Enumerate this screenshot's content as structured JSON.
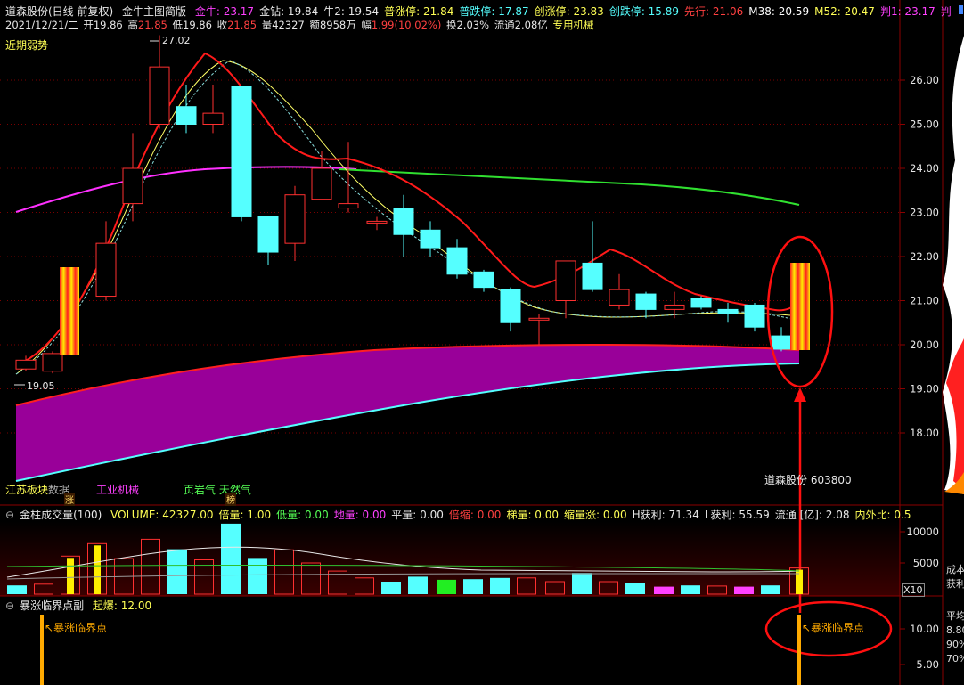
{
  "header": {
    "stock": "道森股份(日线 前复权)",
    "panel": "金牛主图简版",
    "items": [
      {
        "label": "金牛: 23.17",
        "color": "#ff40ff"
      },
      {
        "label": "金钻: 19.84",
        "color": "#e8e8e8"
      },
      {
        "label": "牛2: 19.54",
        "color": "#e8e8e8"
      },
      {
        "label": "普涨停: 21.84",
        "color": "#ffff55"
      },
      {
        "label": "普跌停: 17.87",
        "color": "#55ffff"
      },
      {
        "label": "创涨停: 23.83",
        "color": "#ffff55"
      },
      {
        "label": "创跌停: 15.89",
        "color": "#55ffff"
      },
      {
        "label": "先行: 21.06",
        "color": "#ff4040"
      },
      {
        "label": "M38: 20.59",
        "color": "#ffffff"
      },
      {
        "label": "M52: 20.47",
        "color": "#ffff55"
      },
      {
        "label": "判1: 23.17",
        "color": "#ff40ff"
      },
      {
        "label": "判",
        "color": "#ff40ff"
      }
    ]
  },
  "quote": {
    "date": "2021/12/21/二",
    "open_l": "开",
    "open": "19.86",
    "high_l": "高",
    "high": "21.85",
    "low_l": "低",
    "low": "19.86",
    "close_l": "收",
    "close": "21.85",
    "vol_l": "量",
    "vol": "42327",
    "amt_l": "额",
    "amt": "8958万",
    "chg_l": "幅",
    "chg": "1.99(10.02%)",
    "turn": "换2.03%",
    "float": "流通2.08亿",
    "sector": "专用机械"
  },
  "labels": {
    "trend": "近期弱势",
    "hi": "27.02",
    "lo": "19.05",
    "stock_code": "道森股份 603800",
    "tag1": "江苏板块",
    "tag1b": "数据",
    "tag2": "工业机械",
    "tag3": "页岩气 天然气",
    "badge1": "涨",
    "badge2": "榜"
  },
  "price_axis": [
    "26.00",
    "25.00",
    "24.00",
    "23.00",
    "22.00",
    "21.00",
    "20.00",
    "19.00",
    "18.00"
  ],
  "vol_header": {
    "name": "金柱成交量(100)",
    "items": [
      {
        "label": "VOLUME: 42327.00",
        "color": "#ffff55"
      },
      {
        "label": "倍量: 1.00",
        "color": "#ffff55"
      },
      {
        "label": "低量: 0.00",
        "color": "#55ff55"
      },
      {
        "label": "地量: 0.00",
        "color": "#ff40ff"
      },
      {
        "label": "平量: 0.00",
        "color": "#e8e8e8"
      },
      {
        "label": "倍缩: 0.00",
        "color": "#ff4040"
      },
      {
        "label": "梯量: 0.00",
        "color": "#ffff55"
      },
      {
        "label": "缩量涨: 0.00",
        "color": "#ffff55"
      },
      {
        "label": "H获利: 71.34",
        "color": "#e8e8e8"
      },
      {
        "label": "L获利: 55.59",
        "color": "#e8e8e8"
      },
      {
        "label": "流通 [亿]: 2.08",
        "color": "#e8e8e8"
      },
      {
        "label": "内外比: 0.5",
        "color": "#ffff55"
      }
    ]
  },
  "vol_axis": [
    "10000",
    "5000"
  ],
  "vol_scale": "X10",
  "ind_header": {
    "name": "暴涨临界点副",
    "item": {
      "label": "起爆: 12.00",
      "color": "#ffff55"
    }
  },
  "ind_axis": [
    "10.00",
    "5.00"
  ],
  "ind_labels": {
    "left": "暴涨临界点",
    "right": "暴涨临界点"
  },
  "side_panel": [
    "成本",
    "获利",
    "平均",
    "8.80",
    "90%",
    "70%"
  ],
  "colors": {
    "up": "#ff3030",
    "down": "#55ffff",
    "bg": "#000000",
    "grid": "#800000",
    "zt": "#ffff00"
  }
}
